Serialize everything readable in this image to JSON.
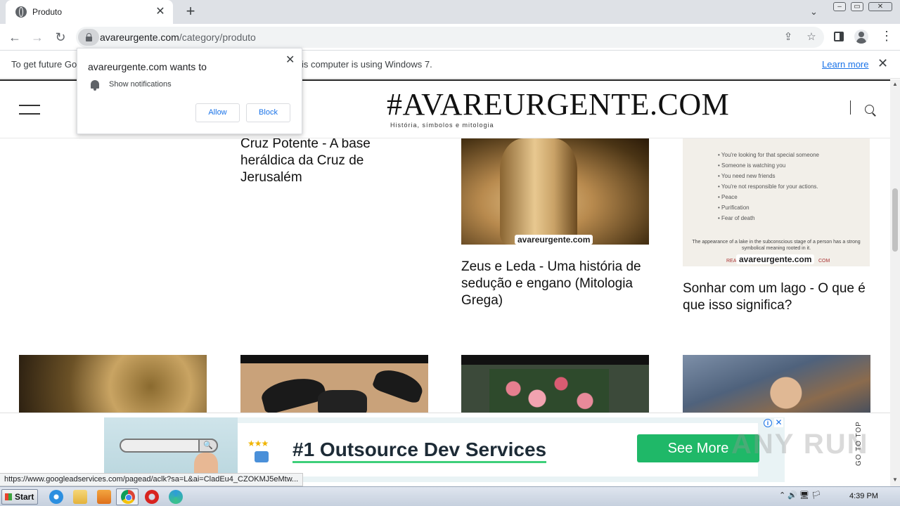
{
  "browser": {
    "tab_title": "Produto",
    "url_domain": "avareurgente.com",
    "url_path": "/category/produto",
    "tab_close": "✕",
    "new_tab": "+",
    "tab_search": "⌄"
  },
  "infobar": {
    "text_left": "To get future Go",
    "text_right": "is computer is using Windows 7.",
    "learn_more": "Learn more",
    "close": "✕"
  },
  "notification": {
    "title": "avareurgente.com wants to",
    "permission": "Show notifications",
    "allow": "Allow",
    "block": "Block",
    "close": "✕"
  },
  "site": {
    "logo": "#AVAREURGENTE.COM",
    "tagline": "História, símbolos e mitologia"
  },
  "posts": {
    "p1_title": "Cruz Potente - A base heráldica da Cruz de Jerusalém",
    "p2_title": "Zeus e Leda - Uma história de sedução e engano (Mitologia Grega)",
    "p3_title": "Sonhar com um lago - O que é que isso significa?",
    "watermark": "avareurgente.com",
    "lake_list": [
      "You're looking for that special someone",
      "Someone is watching you",
      "You need new friends",
      "You're not responsible for your actions.",
      "Peace",
      "Purification",
      "Fear of death"
    ],
    "lake_note": "The appearance of a lake in the subconscious stage of a person has a strong symbolical meaning rooted in it.",
    "lake_footer_left": "REA",
    "lake_footer_right": "COM"
  },
  "ad": {
    "headline": "#1 Outsource Dev Services",
    "cta": "See More",
    "info": "i",
    "close": "✕",
    "stars": "★★★",
    "search_glyph": "🔍"
  },
  "goto_top": "GO TO TOP",
  "watermark_brand": "ANY RUN",
  "status_url": "https://www.googleadservices.com/pagead/aclk?sa=L&ai=CladEu4_CZOKMJ5eMtw...",
  "taskbar": {
    "start": "Start",
    "clock": "4:39 PM",
    "tray": "⌃  🔊  🖥  🏳"
  }
}
